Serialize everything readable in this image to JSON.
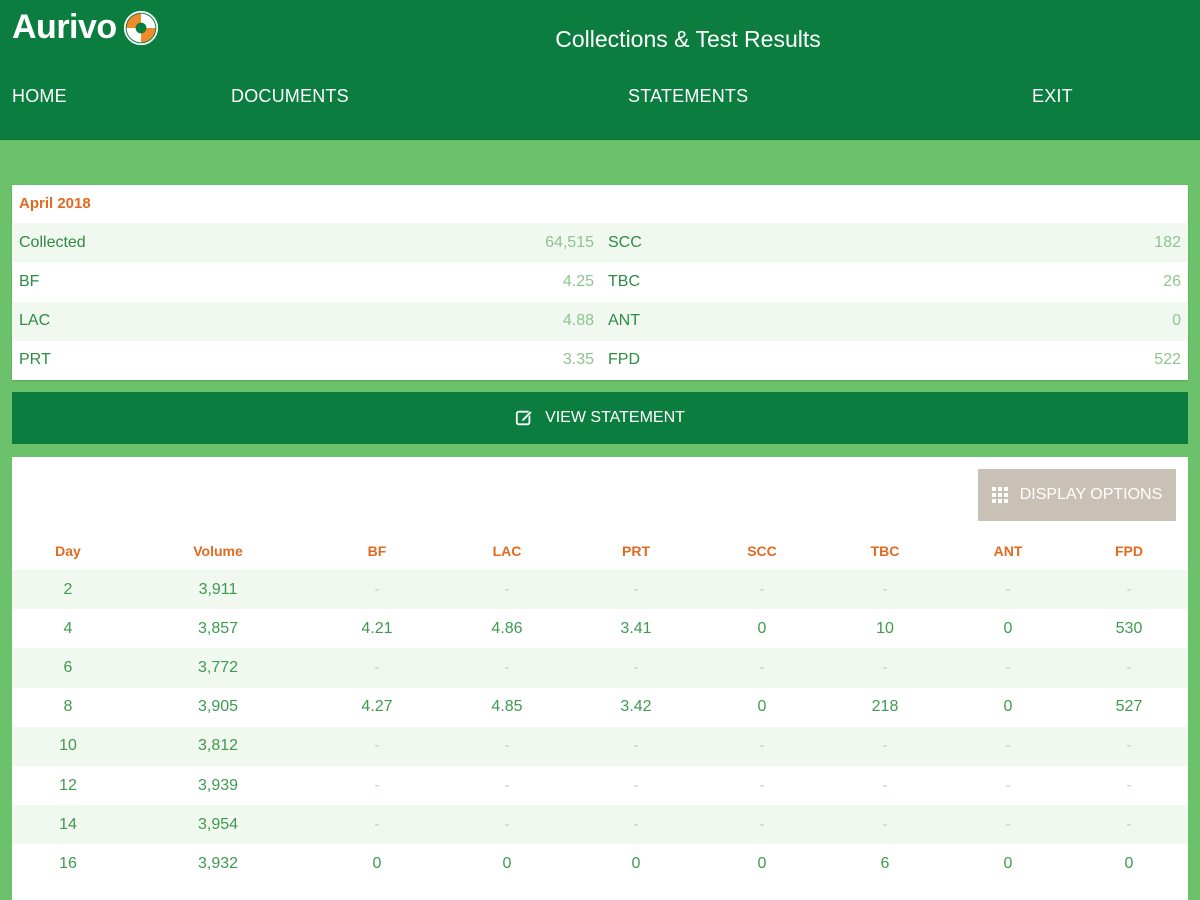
{
  "header": {
    "logo_text": "Aurivo",
    "title": "Collections & Test Results",
    "nav": [
      {
        "label": "HOME"
      },
      {
        "label": "DOCUMENTS"
      },
      {
        "label": "STATEMENTS"
      },
      {
        "label": "EXIT"
      }
    ]
  },
  "summary": {
    "period": "April 2018",
    "rows": [
      {
        "left_label": "Collected",
        "left_value": "64,515",
        "right_label": "SCC",
        "right_value": "182"
      },
      {
        "left_label": "BF",
        "left_value": "4.25",
        "right_label": "TBC",
        "right_value": "26"
      },
      {
        "left_label": "LAC",
        "left_value": "4.88",
        "right_label": "ANT",
        "right_value": "0"
      },
      {
        "left_label": "PRT",
        "left_value": "3.35",
        "right_label": "FPD",
        "right_value": "522"
      }
    ]
  },
  "view_statement": {
    "label": "VIEW STATEMENT",
    "icon": "edit-icon"
  },
  "display_options": {
    "label": "DISPLAY OPTIONS",
    "icon": "grid-icon"
  },
  "table": {
    "columns": [
      "Day",
      "Volume",
      "BF",
      "LAC",
      "PRT",
      "SCC",
      "TBC",
      "ANT",
      "FPD"
    ],
    "rows": [
      [
        "2",
        "3,911",
        "-",
        "-",
        "-",
        "-",
        "-",
        "-",
        "-"
      ],
      [
        "4",
        "3,857",
        "4.21",
        "4.86",
        "3.41",
        "0",
        "10",
        "0",
        "530"
      ],
      [
        "6",
        "3,772",
        "-",
        "-",
        "-",
        "-",
        "-",
        "-",
        "-"
      ],
      [
        "8",
        "3,905",
        "4.27",
        "4.85",
        "3.42",
        "0",
        "218",
        "0",
        "527"
      ],
      [
        "10",
        "3,812",
        "-",
        "-",
        "-",
        "-",
        "-",
        "-",
        "-"
      ],
      [
        "12",
        "3,939",
        "-",
        "-",
        "-",
        "-",
        "-",
        "-",
        "-"
      ],
      [
        "14",
        "3,954",
        "-",
        "-",
        "-",
        "-",
        "-",
        "-",
        "-"
      ],
      [
        "16",
        "3,932",
        "0",
        "0",
        "0",
        "0",
        "6",
        "0",
        "0"
      ]
    ]
  },
  "colors": {
    "header_green": "#0b7d3e",
    "background_green": "#6cc26a",
    "accent_orange": "#e06a1f",
    "text_green": "#3e9a4e",
    "options_gray": "#c9c1b6"
  }
}
